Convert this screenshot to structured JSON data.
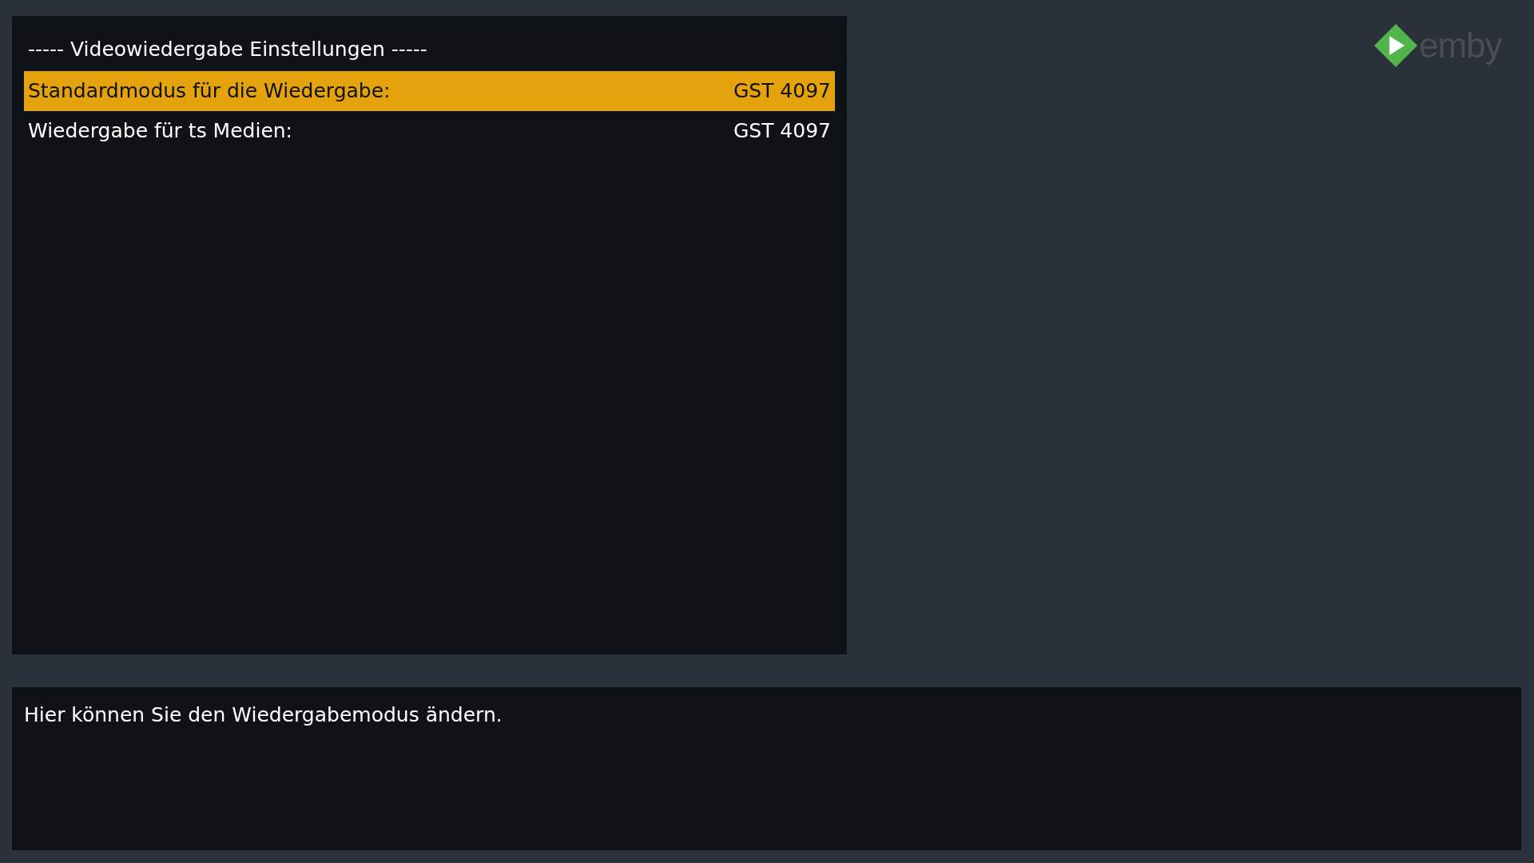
{
  "settings_panel": {
    "title": "----- Videowiedergabe Einstellungen -----",
    "items": [
      {
        "label": "Standardmodus für die Wiedergabe:",
        "value": "GST 4097",
        "selected": true
      },
      {
        "label": "Wiedergabe für ts Medien:",
        "value": "GST 4097",
        "selected": false
      }
    ]
  },
  "logo": {
    "text": "emby"
  },
  "help_panel": {
    "text": "Hier können Sie den Wiedergabemodus ändern."
  }
}
